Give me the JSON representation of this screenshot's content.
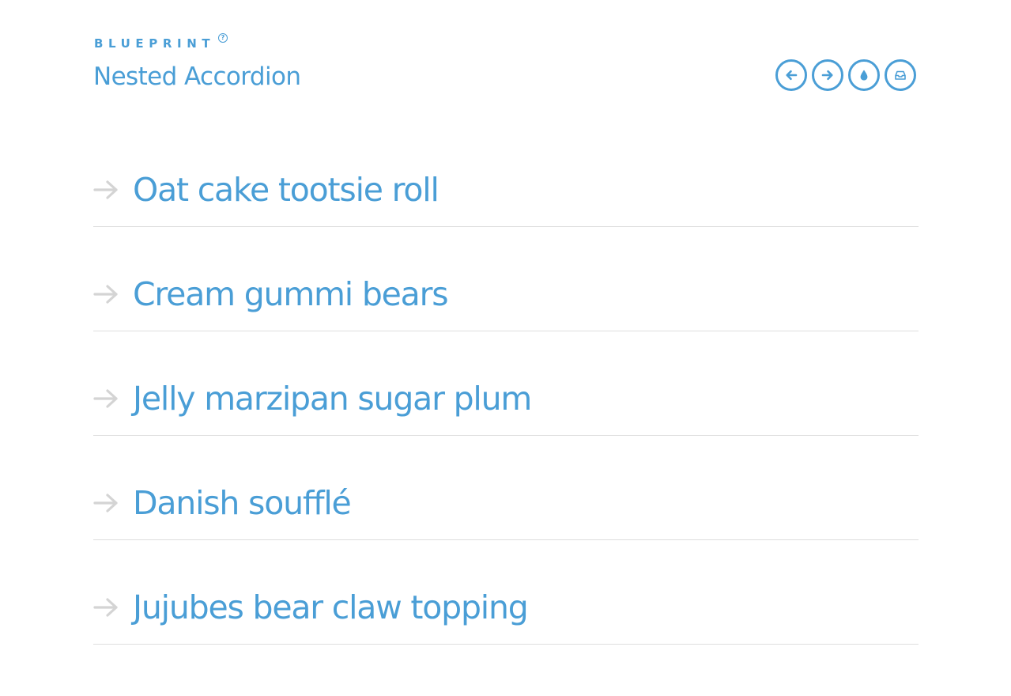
{
  "header": {
    "brand": "BLUEPRINT",
    "brand_help": "?",
    "title": "Nested Accordion"
  },
  "toolbar": {
    "buttons": [
      {
        "icon": "arrow-left-icon"
      },
      {
        "icon": "arrow-right-icon"
      },
      {
        "icon": "droplet-icon"
      },
      {
        "icon": "inbox-icon"
      }
    ]
  },
  "accordion": {
    "items": [
      {
        "label": "Oat cake tootsie roll"
      },
      {
        "label": "Cream gummi bears"
      },
      {
        "label": "Jelly marzipan sugar plum"
      },
      {
        "label": "Danish soufflé"
      },
      {
        "label": "Jujubes bear claw topping"
      }
    ]
  },
  "colors": {
    "accent": "#4a9ed6",
    "arrow": "#d4d4d4",
    "divider": "#dedede"
  }
}
